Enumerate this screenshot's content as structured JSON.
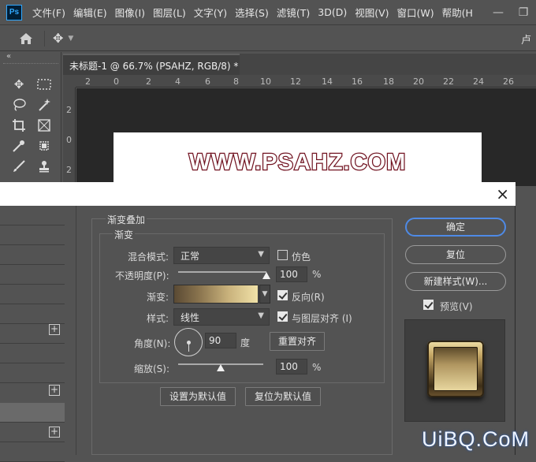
{
  "app": {
    "logo": "Ps",
    "menu": [
      "文件(F)",
      "编辑(E)",
      "图像(I)",
      "图层(L)",
      "文字(Y)",
      "选择(S)",
      "滤镜(T)",
      "3D(D)",
      "视图(V)",
      "窗口(W)",
      "帮助(H"
    ],
    "window_controls": {
      "minimize": "—",
      "restore": "❐"
    },
    "options_right_text": "卢",
    "tools_collapse": "«"
  },
  "document": {
    "tab_title": "未标题-1 @ 66.7% (PSAHZ, RGB/8) *",
    "tab_close": "×",
    "canvas_text": "WWW.PSAHZ.COM",
    "ruler_top": [
      "2",
      "0",
      "2",
      "4",
      "6",
      "8",
      "10",
      "12",
      "14",
      "16",
      "18",
      "20",
      "22",
      "24",
      "26"
    ],
    "ruler_left": [
      "2",
      "0",
      "2"
    ]
  },
  "dialog": {
    "close": "×",
    "section_title": "渐变叠加",
    "group_title": "渐变",
    "blend_mode_label": "混合模式:",
    "blend_mode_value": "正常",
    "dither_label": "仿色",
    "dither_checked": false,
    "opacity_label": "不透明度(P):",
    "opacity_value": "100",
    "opacity_unit": "%",
    "opacity_fraction": 1.0,
    "gradient_label": "渐变:",
    "gradient_colors": [
      "#5a4a34",
      "#8a744e",
      "#c9b27c",
      "#f1e2a8"
    ],
    "reverse_label": "反向(R)",
    "reverse_checked": true,
    "style_label": "样式:",
    "style_value": "线性",
    "align_label": "与图层对齐 (I)",
    "align_checked": true,
    "angle_label": "角度(N):",
    "angle_value": "90",
    "angle_unit": "度",
    "reset_align_button": "重置对齐",
    "scale_label": "缩放(S):",
    "scale_value": "100",
    "scale_unit": "%",
    "scale_fraction": 0.5,
    "set_default_button": "设置为默认值",
    "reset_default_button": "复位为默认值",
    "ok_button": "确定",
    "reset_button": "复位",
    "new_style_button": "新建样式(W)...",
    "preview_label": "预览(V)",
    "preview_checked": true,
    "plus": "+"
  },
  "watermark": "UiBQ.CoM",
  "colors": {
    "panel": "#535353",
    "accent_button": "#4e8ae6",
    "canvas_text_stroke": "#7a1524"
  }
}
